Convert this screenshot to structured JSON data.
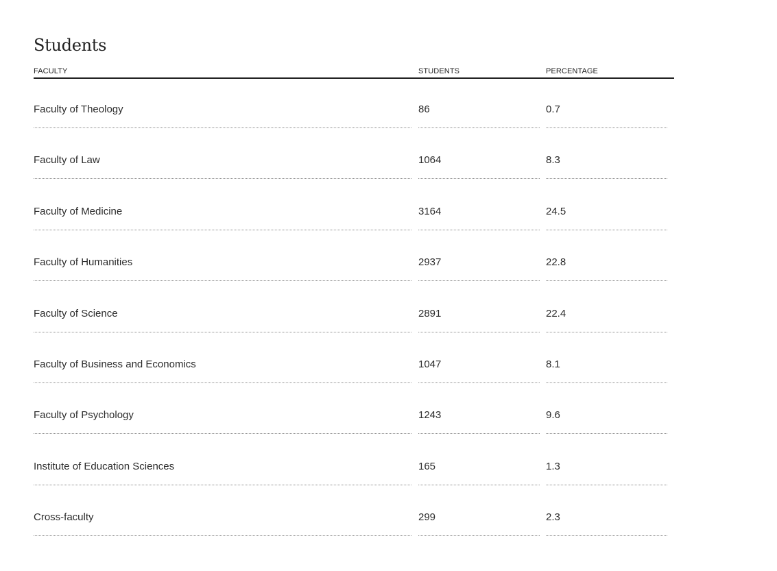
{
  "table": {
    "title": "Students",
    "headers": {
      "faculty": "FACULTY",
      "students": "STUDENTS",
      "percentage": "PERCENTAGE"
    },
    "rows": [
      {
        "faculty": "Faculty of Theology",
        "students": "86",
        "percentage": "0.7"
      },
      {
        "faculty": "Faculty of Law",
        "students": "1064",
        "percentage": "8.3"
      },
      {
        "faculty": "Faculty of Medicine",
        "students": "3164",
        "percentage": "24.5"
      },
      {
        "faculty": "Faculty of Humanities",
        "students": "2937",
        "percentage": "22.8"
      },
      {
        "faculty": "Faculty of Science",
        "students": "2891",
        "percentage": "22.4"
      },
      {
        "faculty": "Faculty of Business and Economics",
        "students": "1047",
        "percentage": "8.1"
      },
      {
        "faculty": "Faculty of Psychology",
        "students": "1243",
        "percentage": "9.6"
      },
      {
        "faculty": "Institute of Education Sciences",
        "students": "165",
        "percentage": "1.3"
      },
      {
        "faculty": "Cross-faculty",
        "students": "299",
        "percentage": "2.3"
      }
    ]
  },
  "colors": {
    "text": "#222222",
    "rule": "#1f1f1f",
    "dotted_rule": "#8a8a8a",
    "background": "#ffffff"
  }
}
